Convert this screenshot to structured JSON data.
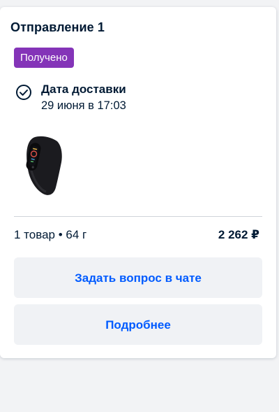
{
  "shipment": {
    "title": "Отправление 1",
    "status_badge": "Получено",
    "status_color": "#8434b8",
    "delivery": {
      "label": "Дата доставки",
      "date": "29 июня в 17:03",
      "icon": "check-circle-icon"
    },
    "product_image": "fitness-band-image",
    "summary": "1 товар • 64 г",
    "price": "2 262 ₽"
  },
  "actions": {
    "ask_chat_label": "Задать вопрос в чате",
    "details_label": "Подробнее"
  },
  "colors": {
    "accent": "#005bff",
    "text": "#001a34",
    "button_bg": "#f0f2f5",
    "page_bg": "#f2f3f5"
  }
}
